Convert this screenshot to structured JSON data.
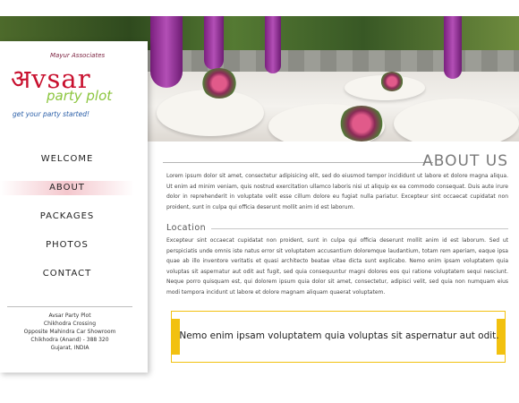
{
  "brand": {
    "associates": "Mayur Associates",
    "name": "अvsar",
    "subtitle": "party plot",
    "tagline": "get your party started!"
  },
  "nav": {
    "items": [
      {
        "label": "WELCOME",
        "active": false
      },
      {
        "label": "ABOUT",
        "active": true
      },
      {
        "label": "PACKAGES",
        "active": false
      },
      {
        "label": "PHOTOS",
        "active": false
      },
      {
        "label": "CONTACT",
        "active": false
      }
    ]
  },
  "address": {
    "lines": [
      "Avsar Party Plot",
      "Chikhodra Crossing",
      "Opposite Mahindra Car Showroom",
      "Chikhodra (Anand) - 388 320",
      "Gujarat, INDIA"
    ]
  },
  "main": {
    "title": "ABOUT US",
    "intro": "Lorem ipsum dolor sit amet, consectetur adipisicing elit, sed do eiusmod tempor incididunt ut labore et dolore magna aliqua. Ut enim ad minim veniam, quis nostrud exercitation ullamco laboris nisi ut aliquip ex ea commodo consequat. Duis aute irure dolor in reprehenderit in voluptate velit esse cillum dolore eu fugiat nulla pariatur. Excepteur sint occaecat cupidatat non proident, sunt in culpa qui officia deserunt mollit anim id est laborum.",
    "location_heading": "Location",
    "location_text": "Excepteur sint occaecat cupidatat non proident, sunt in culpa qui officia deserunt mollit anim id est laborum. Sed ut perspiciatis unde omnis iste natus error sit voluptatem accusantium doloremque laudantium, totam rem aperiam, eaque ipsa quae ab illo inventore veritatis et quasi architecto beatae vitae dicta sunt explicabo. Nemo enim ipsam voluptatem quia voluptas sit aspernatur aut odit aut fugit, sed quia consequuntur magni dolores eos qui ratione voluptatem sequi nesciunt. Neque porro quisquam est, qui dolorem ipsum quia dolor sit amet, consectetur, adipisci velit, sed quia non numquam eius modi tempora incidunt ut labore et dolore magnam aliquam quaerat voluptatem.",
    "quote": "Nemo enim ipsam voluptatem quia voluptas sit aspernatur aut odit."
  },
  "colors": {
    "brand_red": "#c8102e",
    "brand_green": "#8cc63f",
    "tagline_blue": "#2b5fa8",
    "quote_accent": "#f2c10f",
    "active_nav": "#f4c7cd"
  }
}
